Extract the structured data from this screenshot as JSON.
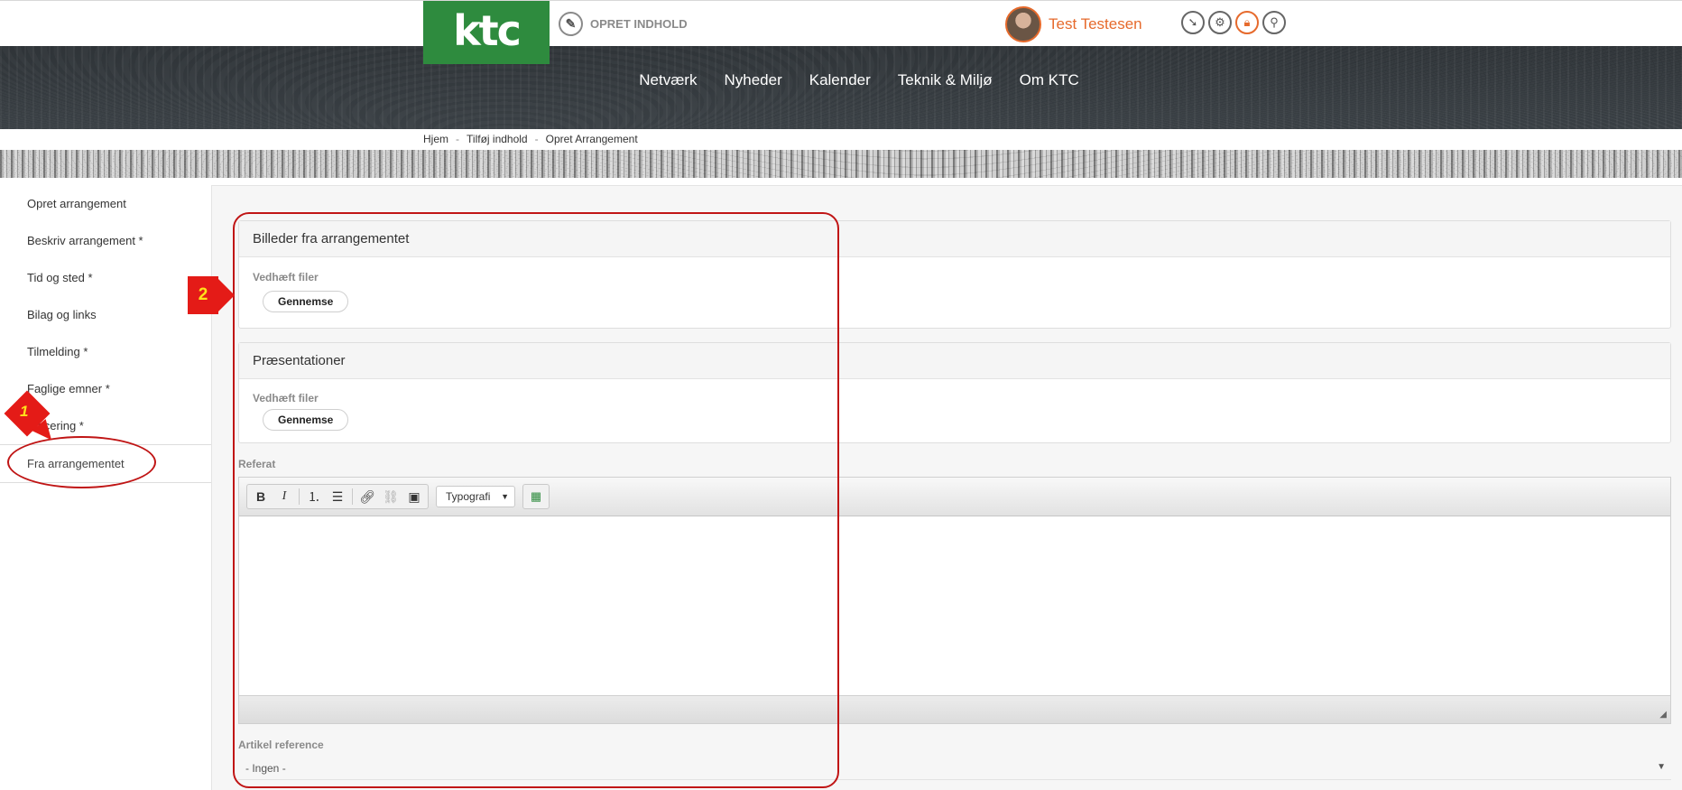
{
  "header": {
    "logo_text": "ktc",
    "create_label": "OPRET INDHOLD",
    "user_name": "Test Testesen",
    "icons": [
      "arrow-down-icon",
      "gear-icon",
      "lock-icon",
      "search-icon"
    ],
    "accent_color": "#e66a2c",
    "brand_color": "#2e8b3e"
  },
  "nav": {
    "items": [
      "Netværk",
      "Nyheder",
      "Kalender",
      "Teknik & Miljø",
      "Om KTC"
    ]
  },
  "breadcrumb": {
    "items": [
      "Hjem",
      "Tilføj indhold",
      "Opret Arrangement"
    ],
    "separator": "-"
  },
  "sidebar": {
    "items": [
      {
        "label": "Opret arrangement"
      },
      {
        "label": "Beskriv arrangement *"
      },
      {
        "label": "Tid og sted *"
      },
      {
        "label": "Bilag og links"
      },
      {
        "label": "Tilmelding *"
      },
      {
        "label": "Faglige emner *"
      },
      {
        "label": "Placering *"
      },
      {
        "label": "Fra arrangementet"
      }
    ],
    "active_index": 7
  },
  "sections": {
    "images": {
      "title": "Billeder fra arrangementet",
      "field_label": "Vedhæft filer",
      "button": "Gennemse"
    },
    "presentations": {
      "title": "Præsentationer",
      "field_label": "Vedhæft filer",
      "button": "Gennemse"
    }
  },
  "referat": {
    "label": "Referat",
    "toolbar": {
      "bold": "B",
      "italic": "I",
      "typography_select": "Typografi"
    }
  },
  "article_reference": {
    "label": "Artikel reference",
    "value": "- Ingen -"
  },
  "annotations": {
    "marker_1": "1",
    "marker_2": "2",
    "color": "#c01515"
  }
}
